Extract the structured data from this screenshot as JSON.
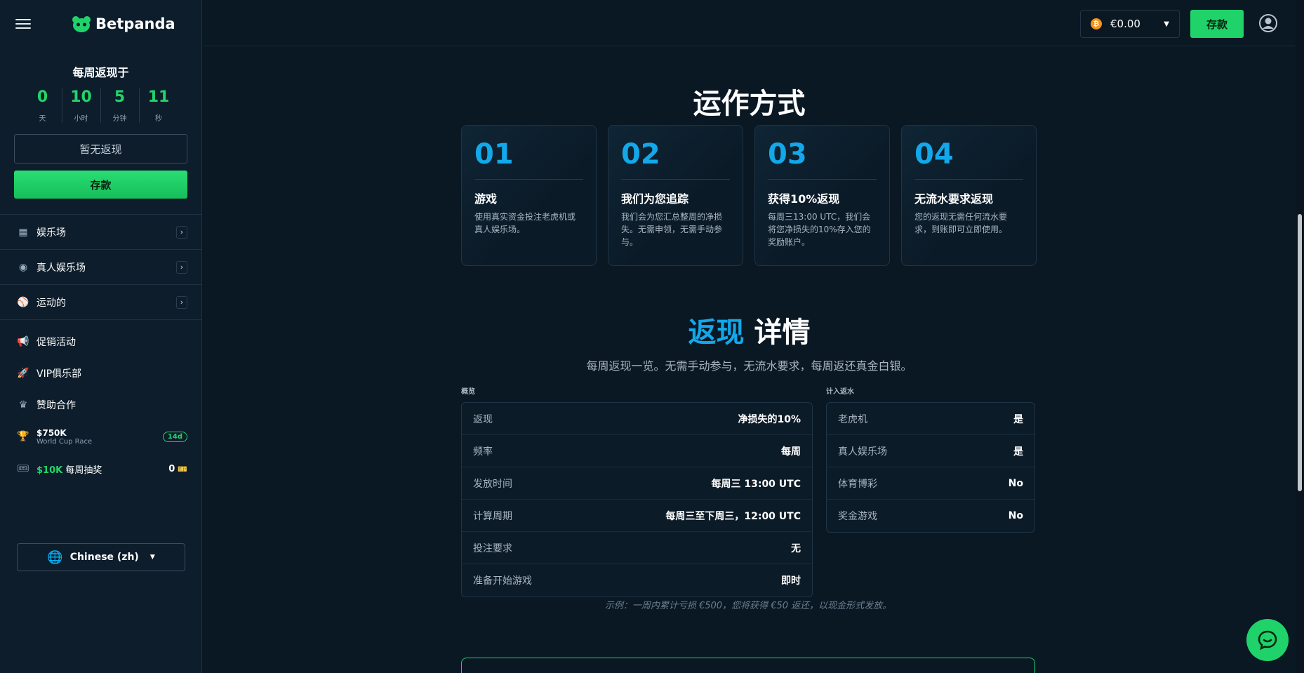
{
  "brand": {
    "name": "Betpanda"
  },
  "cashback": {
    "title": "每周返现于",
    "countdown": [
      {
        "value": "0",
        "unit": "天"
      },
      {
        "value": "10",
        "unit": "小时"
      },
      {
        "value": "5",
        "unit": "分钟"
      },
      {
        "value": "11",
        "unit": "秒"
      }
    ],
    "empty_label": "暂无返现",
    "deposit_label": "存款"
  },
  "nav": {
    "items": [
      {
        "label": "娱乐场",
        "icon": "casino-icon"
      },
      {
        "label": "真人娱乐场",
        "icon": "live-icon"
      },
      {
        "label": "运动的",
        "icon": "sports-ball-icon"
      }
    ],
    "links": [
      {
        "label": "促销活动",
        "icon": "megaphone-icon"
      },
      {
        "label": "VIP俱乐部",
        "icon": "rocket-icon"
      },
      {
        "label": "赞助合作",
        "icon": "crown-icon"
      }
    ],
    "race": {
      "amount": "$750K",
      "name": "World Cup Race",
      "badge": "14d"
    },
    "raffle": {
      "amount": "$10K",
      "label": "每周抽奖",
      "count": "0"
    }
  },
  "language": {
    "label": "Chinese (zh)"
  },
  "topbar": {
    "balance": "€0.00",
    "currency_symbol": "₿",
    "deposit_label": "存款"
  },
  "how": {
    "title": "运作方式",
    "steps": [
      {
        "num": "01",
        "title": "游戏",
        "desc": "使用真实资金投注老虎机或真人娱乐场。"
      },
      {
        "num": "02",
        "title": "我们为您追踪",
        "desc": "我们会为您汇总整周的净损失。无需申领，无需手动参与。"
      },
      {
        "num": "03",
        "title": "获得10%返现",
        "desc": "每周三13:00 UTC，我们会将您净损失的10%存入您的奖励账户。"
      },
      {
        "num": "04",
        "title": "无流水要求返现",
        "desc": "您的返现无需任何流水要求，到账即可立即使用。"
      }
    ]
  },
  "details": {
    "title_highlight": "返现",
    "title_rest": " 详情",
    "subtitle": "每周返现一览。无需手动参与，无流水要求，每周返还真金白银。",
    "overview_label": "概览",
    "overview": [
      {
        "k": "返现",
        "v": "净损失的10%"
      },
      {
        "k": "频率",
        "v": "每周"
      },
      {
        "k": "发放时间",
        "v": "每周三 13:00 UTC"
      },
      {
        "k": "计算周期",
        "v": "每周三至下周三，12:00 UTC"
      },
      {
        "k": "投注要求",
        "v": "无"
      },
      {
        "k": "准备开始游戏",
        "v": "即时"
      }
    ],
    "counts_label": "计入返水",
    "counts": [
      {
        "k": "老虎机",
        "v": "是"
      },
      {
        "k": "真人娱乐场",
        "v": "是"
      },
      {
        "k": "体育博彩",
        "v": "No"
      },
      {
        "k": "奖金游戏",
        "v": "No"
      }
    ],
    "example": "示例：一周内累计亏损 €500，您将获得 €50 返还，以现金形式发放。"
  },
  "colors": {
    "accent_green": "#1fd26a",
    "accent_blue": "#12a8ea",
    "background": "#0a1824"
  }
}
